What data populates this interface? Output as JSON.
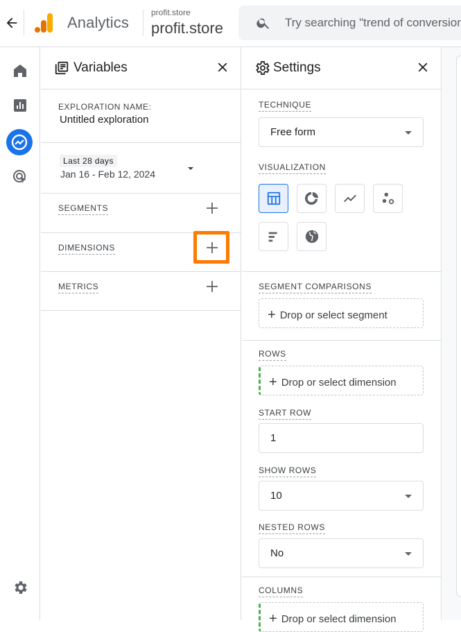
{
  "topbar": {
    "product_name": "Analytics",
    "account_name": "profit.store",
    "property_name": "profit.store",
    "search_placeholder": "Try searching \"trend of conversions\""
  },
  "leftnav": {
    "items": [
      {
        "name": "home-icon",
        "active": false
      },
      {
        "name": "reports-icon",
        "active": false
      },
      {
        "name": "explore-icon",
        "active": true
      },
      {
        "name": "advertising-icon",
        "active": false
      }
    ],
    "footer_icon": "gear-icon",
    "accent_color": "#1a73e8"
  },
  "variables": {
    "title": "Variables",
    "exploration_name_label": "EXPLORATION NAME:",
    "exploration_name": "Untitled exploration",
    "date_preset": "Last 28 days",
    "date_range": "Jan 16 - Feb 12, 2024",
    "sections": [
      {
        "label": "SEGMENTS"
      },
      {
        "label": "DIMENSIONS"
      },
      {
        "label": "METRICS"
      }
    ],
    "highlight_color": "#ff7a00"
  },
  "settings": {
    "title": "Settings",
    "technique_label": "TECHNIQUE",
    "technique_value": "Free form",
    "visualization_label": "VISUALIZATION",
    "visualizations": [
      {
        "name": "table-viz-icon",
        "active": true
      },
      {
        "name": "donut-chart-viz-icon",
        "active": false
      },
      {
        "name": "line-chart-viz-icon",
        "active": false
      },
      {
        "name": "scatter-plot-viz-icon",
        "active": false
      },
      {
        "name": "bar-chart-viz-icon",
        "active": false
      },
      {
        "name": "geo-map-viz-icon",
        "active": false
      }
    ],
    "segment_comparisons_label": "SEGMENT COMPARISONS",
    "segment_drop": "Drop or select segment",
    "rows_label": "ROWS",
    "rows_drop": "Drop or select dimension",
    "start_row_label": "START ROW",
    "start_row_value": "1",
    "show_rows_label": "SHOW ROWS",
    "show_rows_value": "10",
    "nested_rows_label": "NESTED ROWS",
    "nested_rows_value": "No",
    "columns_label": "COLUMNS",
    "columns_drop": "Drop or select dimension"
  }
}
